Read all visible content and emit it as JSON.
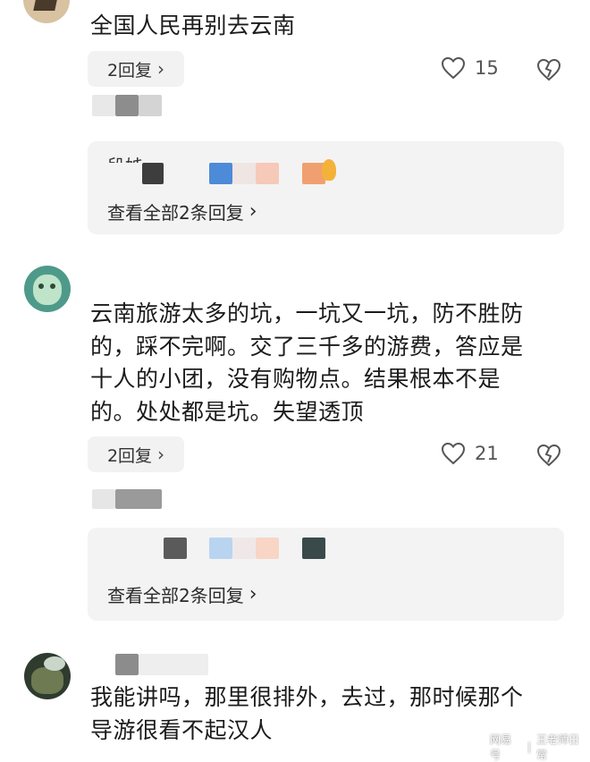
{
  "comments": [
    {
      "text": "全国人民再别去云南",
      "reply_label": "2回复",
      "likes": "15",
      "panel_partial_name": "段姊",
      "view_all_label": "查看全部2条回复"
    },
    {
      "text_lines": [
        "云南旅游太多的坑，一坑又一坑，防不胜防",
        "的，踩不完啊。交了三千多的游费，答应是",
        "十人的小团，没有购物点。结果根本不是",
        "的。处处都是坑。失望透顶"
      ],
      "reply_label": "2回复",
      "likes": "21",
      "view_all_label": "查看全部2条回复"
    },
    {
      "text_lines": [
        "我能讲吗，那里很排外，去过，那时候那个",
        "导游很看不起汉人"
      ]
    }
  ],
  "watermark": {
    "site": "网易号",
    "author": "王老师日常"
  },
  "icons": {
    "heart": "heart-outline-icon",
    "dislike": "broken-heart-icon",
    "chevron": "chevron-right-icon"
  }
}
